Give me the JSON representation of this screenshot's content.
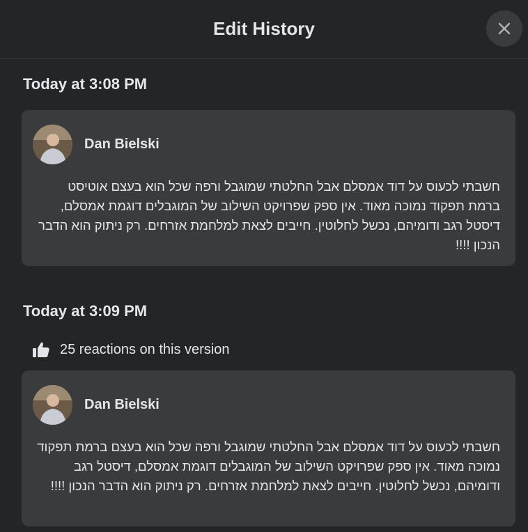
{
  "dialog": {
    "title": "Edit History"
  },
  "versions": [
    {
      "time": "Today at 3:08 PM",
      "author": "Dan Bielski",
      "text": "חשבתי לכעוס על דוד אמסלם אבל החלטתי שמוגבל ורפה שכל הוא בעצם אוטיסט ברמת תפקוד נמוכה מאוד. אין ספק שפרויקט השילוב של המוגבלים דוגמת אמסלם, דיסטל רגב ודומיהם, נכשל לחלוטין. חייבים לצאת למלחמת אזרחים. רק ניתוק הוא הדבר הנכון !!!!"
    },
    {
      "time": "Today at 3:09 PM",
      "reactions": "25 reactions on this version",
      "author": "Dan Bielski",
      "text": "חשבתי לכעוס על דוד אמסלם אבל החלטתי שמוגבל ורפה שכל הוא בעצם ברמת תפקוד נמוכה מאוד. אין ספק שפרויקט השילוב של המוגבלים דוגמת אמסלם, דיסטל רגב ודומיהם, נכשל לחלוטין. חייבים לצאת למלחמת אזרחים. רק ניתוק הוא הדבר הנכון !!!!"
    }
  ],
  "icons": {
    "close": "close-icon",
    "like": "thumbs-up-icon"
  },
  "colors": {
    "background": "#242526",
    "card": "#3a3b3c",
    "text": "#e4e6eb"
  }
}
